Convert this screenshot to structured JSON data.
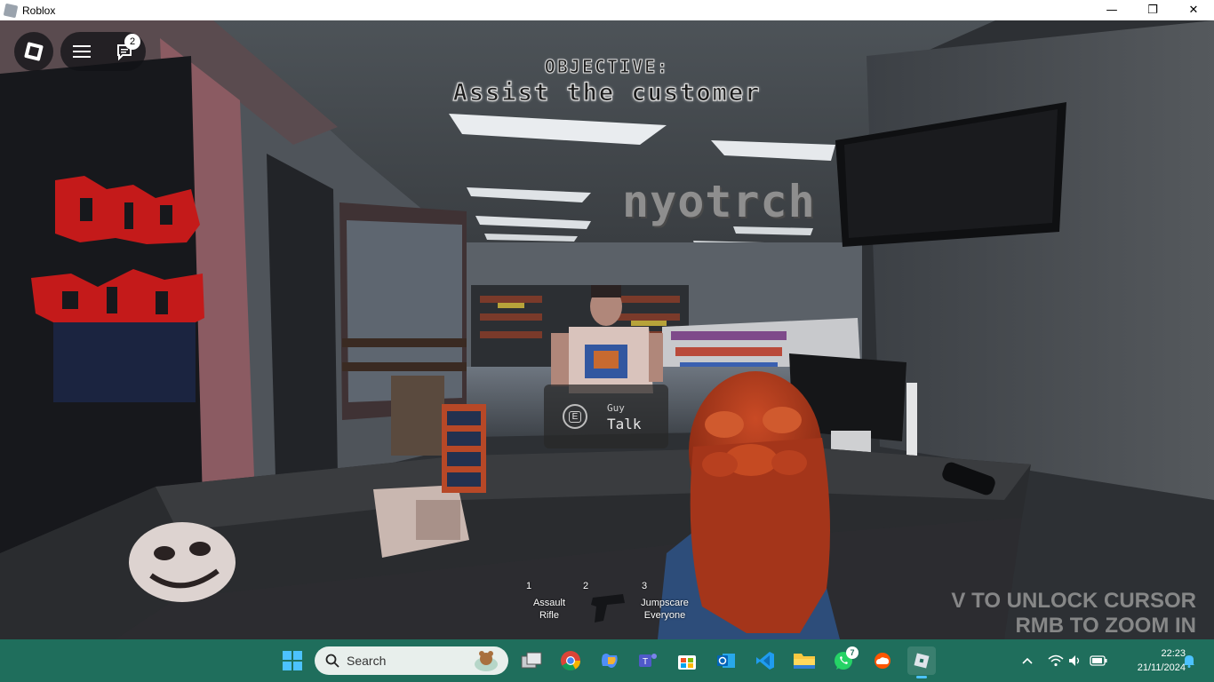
{
  "window": {
    "title": "Roblox",
    "controls": [
      "—",
      "❐",
      "✕"
    ]
  },
  "roblox_ui": {
    "chat_badge": "2",
    "icons": [
      "roblox-logo-icon",
      "hamburger-menu-icon",
      "chat-icon"
    ]
  },
  "objective": {
    "heading": "OBJECTIVE:",
    "text": "Assist the customer"
  },
  "scene_text": {
    "wall_sign": "nyotrch"
  },
  "prompt": {
    "key": "E",
    "object": "Guy",
    "action": "Talk"
  },
  "hotbar": [
    {
      "key": "1",
      "label_line1": "Assault",
      "label_line2": "Rifle"
    },
    {
      "key": "2",
      "icon": "pistol-icon"
    },
    {
      "key": "3",
      "label_line1": "Jumpscare",
      "label_line2": "Everyone"
    }
  ],
  "hints": {
    "line1": "V TO UNLOCK CURSOR",
    "line2": "RMB TO ZOOM IN"
  },
  "taskbar": {
    "search_placeholder": "Search",
    "apps": [
      "start-icon",
      "task-view-icon",
      "chrome-icon",
      "copilot-icon",
      "teams-icon",
      "store-icon",
      "outlook-icon",
      "vscode-icon",
      "file-explorer-icon",
      "whatsapp-icon",
      "soundcloud-icon",
      "roblox-icon"
    ],
    "whatsapp_badge": "7",
    "clock_time": "22:23",
    "clock_date": "21/11/2024",
    "tray": [
      "chevron-up-icon",
      "wifi-icon",
      "speaker-icon",
      "battery-icon",
      "bell-icon"
    ]
  },
  "colors": {
    "taskbar": "#1f6e5c",
    "hair": "#b8341b"
  }
}
